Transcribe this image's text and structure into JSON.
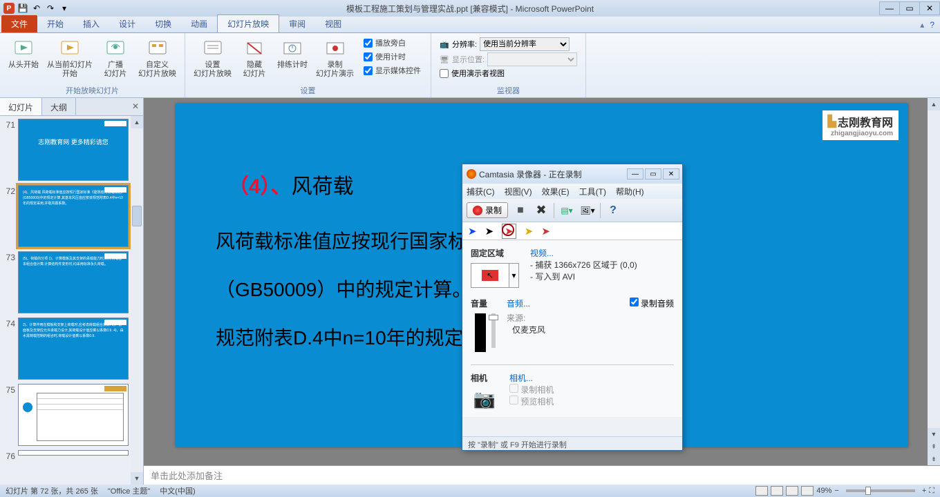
{
  "titlebar": {
    "title": "模板工程施工策划与管理实战.ppt [兼容模式] - Microsoft PowerPoint"
  },
  "tabs": {
    "file": "文件",
    "items": [
      "开始",
      "插入",
      "设计",
      "切换",
      "动画",
      "幻灯片放映",
      "审阅",
      "视图"
    ],
    "active_index": 5
  },
  "ribbon": {
    "group1_label": "开始放映幻灯片",
    "btn_from_start": "从头开始",
    "btn_from_current": "从当前幻灯片\n开始",
    "btn_broadcast": "广播\n幻灯片",
    "btn_custom": "自定义\n幻灯片放映",
    "group2_label": "设置",
    "btn_setup": "设置\n幻灯片放映",
    "btn_hide": "隐藏\n幻灯片",
    "btn_rehearse": "排练计时",
    "btn_record": "录制\n幻灯片演示",
    "chk_narration": "播放旁白",
    "chk_timings": "使用计时",
    "chk_controls": "显示媒体控件",
    "group3_label": "监视器",
    "lbl_resolution": "分辨率:",
    "sel_resolution": "使用当前分辨率",
    "lbl_show_on": "显示位置:",
    "chk_presenter": "使用演示者视图"
  },
  "side": {
    "tab_slides": "幻灯片",
    "tab_outline": "大纲",
    "thumbs": [
      {
        "num": "71",
        "content": "志刚教育网\n更多精彩请您"
      },
      {
        "num": "72",
        "content": "(4)、风荷载\n风荷载标准值应按现行国家标准《建筑结构荷载规范》(GB50009)中的规定计算,其基本风压值应按该规范附表D.4中n=10年的规定采用,并取风振系数。",
        "selected": true
      },
      {
        "num": "73",
        "content": "(5)、荷载的分项\n1)、计算模板及其支架的承载能力时,采用荷载基本组合值计算,计算结构件变形时,均采用标准永久荷载。"
      },
      {
        "num": "74",
        "content": "2)、计算作用在模板和支架上荷载时,应考虑荷载组合系数.\n3)、钢面板及支架应允许承载力设计,其荷载设计值应乘以系数0.9.\n4)、由水需荷载控制的组合时,荷载设计值乘以系数0.9."
      },
      {
        "num": "75",
        "content": ""
      },
      {
        "num": "76",
        "content": ""
      }
    ]
  },
  "slide": {
    "watermark": "志刚教育网",
    "watermark_sub": "zhigangjiaoyu.com",
    "heading_num": "（4）、",
    "heading_text": "风荷载",
    "body_line1": "风荷载标准值应按现行国家标准《建筑结构荷载规范》",
    "body_line2": "（GB50009）中的规定计算。基本风压值应按该",
    "body_line3": "规范附表D.4中n=10年的规定采用，并取风振系数 。"
  },
  "notes": {
    "placeholder": "单击此处添加备注"
  },
  "camtasia": {
    "title": "Camtasia 录像器 - 正在录制",
    "menu": [
      "捕获(C)",
      "视图(V)",
      "效果(E)",
      "工具(T)",
      "帮助(H)"
    ],
    "rec_label": "录制",
    "region_label": "固定区域",
    "video_label": "视频...",
    "video_line1": "- 捕获 1366x726 区域于 (0,0)",
    "video_line2": "- 写入到 AVI",
    "volume_label": "音量",
    "audio_label": "音频...",
    "chk_rec_audio": "录制音频",
    "source_label": "来源:",
    "source_value": "仅麦克风",
    "camera_label": "相机",
    "camera_link": "相机...",
    "chk_rec_camera": "录制相机",
    "chk_preview_camera": "预览相机",
    "status": "按 \"录制\" 或 F9 开始进行录制"
  },
  "statusbar": {
    "slide_info": "幻灯片 第 72 张，共 265 张",
    "theme": "\"Office 主题\"",
    "lang": "中文(中国)",
    "zoom": "49%"
  }
}
